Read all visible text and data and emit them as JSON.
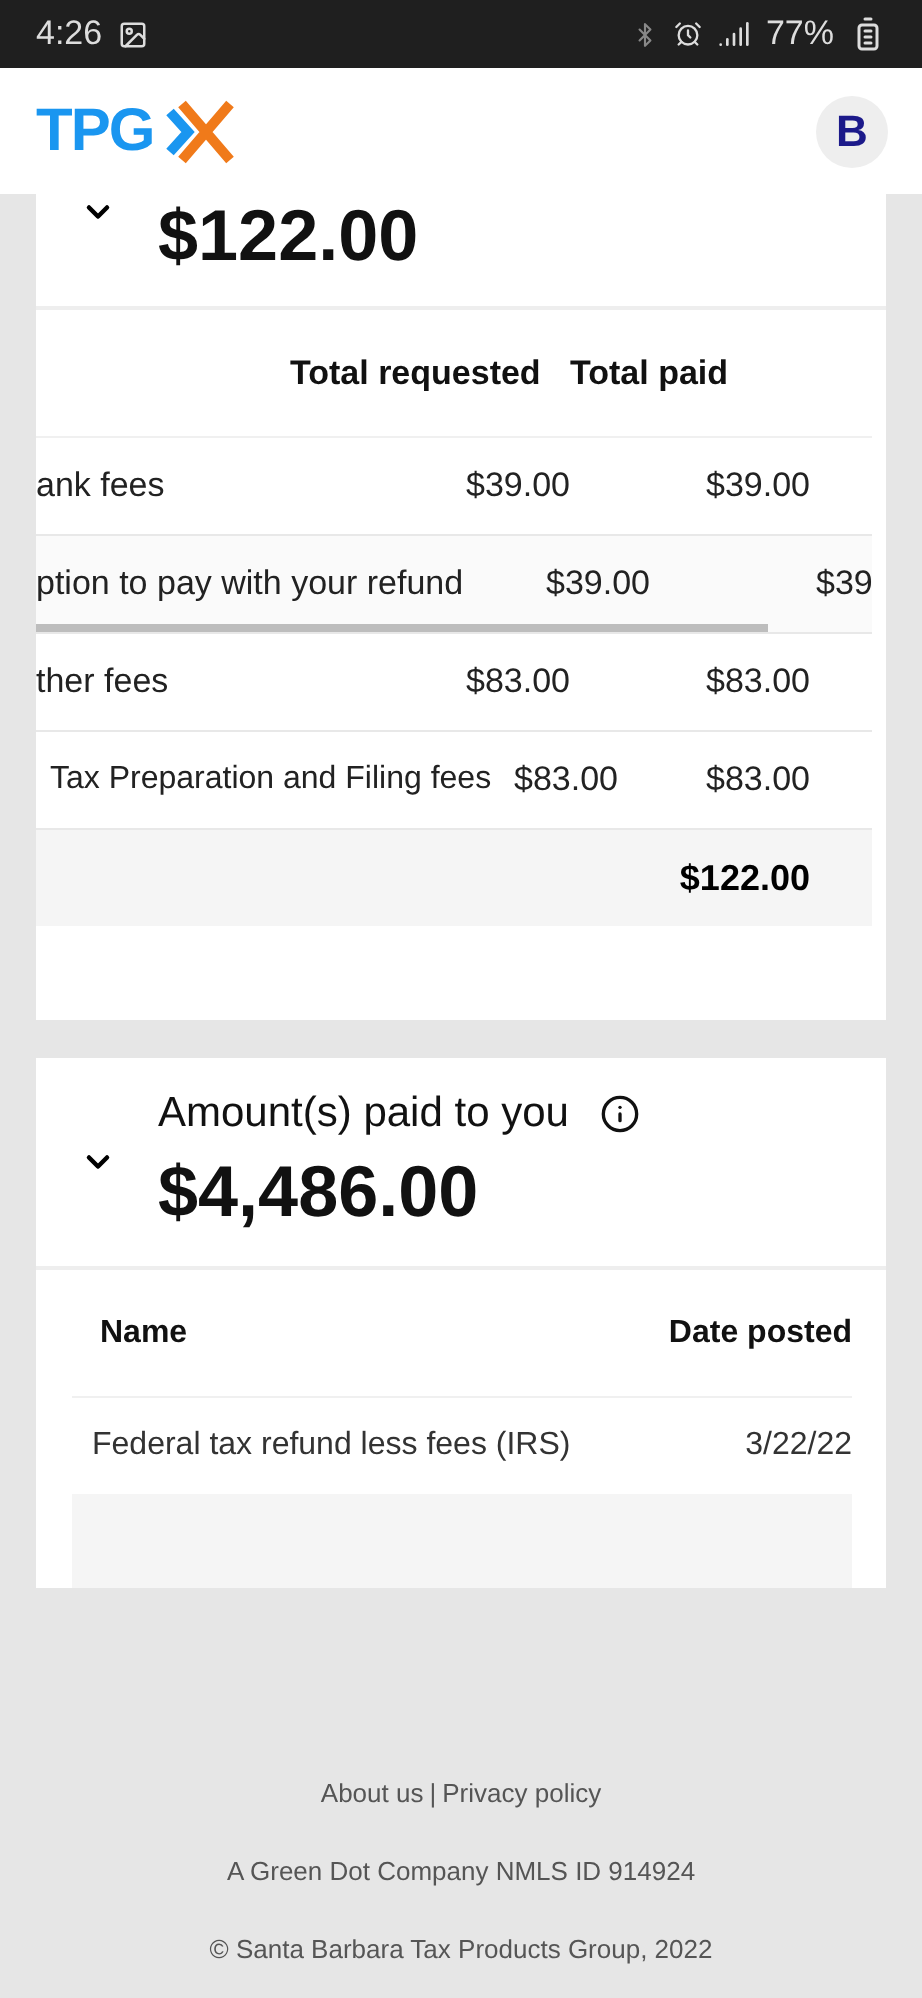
{
  "status_bar": {
    "time": "4:26",
    "battery": "77%"
  },
  "header": {
    "logo_text": "TPG",
    "avatar_initial": "B"
  },
  "fees_card": {
    "expanded": true,
    "amount": "$122.00",
    "table": {
      "columns": [
        "Total requested",
        "Total paid"
      ],
      "rows": [
        {
          "kind": "category",
          "label": "ank fees",
          "requested": "$39.00",
          "paid": "$39.00"
        },
        {
          "kind": "detail",
          "label": "ption to pay with your refund",
          "requested": "$39.00",
          "paid": "$39"
        },
        {
          "kind": "category",
          "label": "ther fees",
          "requested": "$83.00",
          "paid": "$83.00"
        },
        {
          "kind": "subitem",
          "label": "Tax Preparation and Filing fees",
          "requested": "$83.00",
          "paid": "$83.00"
        }
      ],
      "total": "$122.00"
    }
  },
  "payments_card": {
    "expanded": true,
    "title": "Amount(s) paid to you",
    "amount": "$4,486.00",
    "table": {
      "columns": [
        "Name",
        "Date posted"
      ],
      "rows": [
        {
          "name": "Federal tax refund less fees (IRS)",
          "date": "3/22/22"
        }
      ]
    }
  },
  "footer": {
    "links": [
      "About us",
      "Privacy policy"
    ],
    "separator": "|",
    "company": "A Green Dot Company NMLS ID 914924",
    "copyright": "© Santa Barbara Tax Products Group, 2022"
  }
}
